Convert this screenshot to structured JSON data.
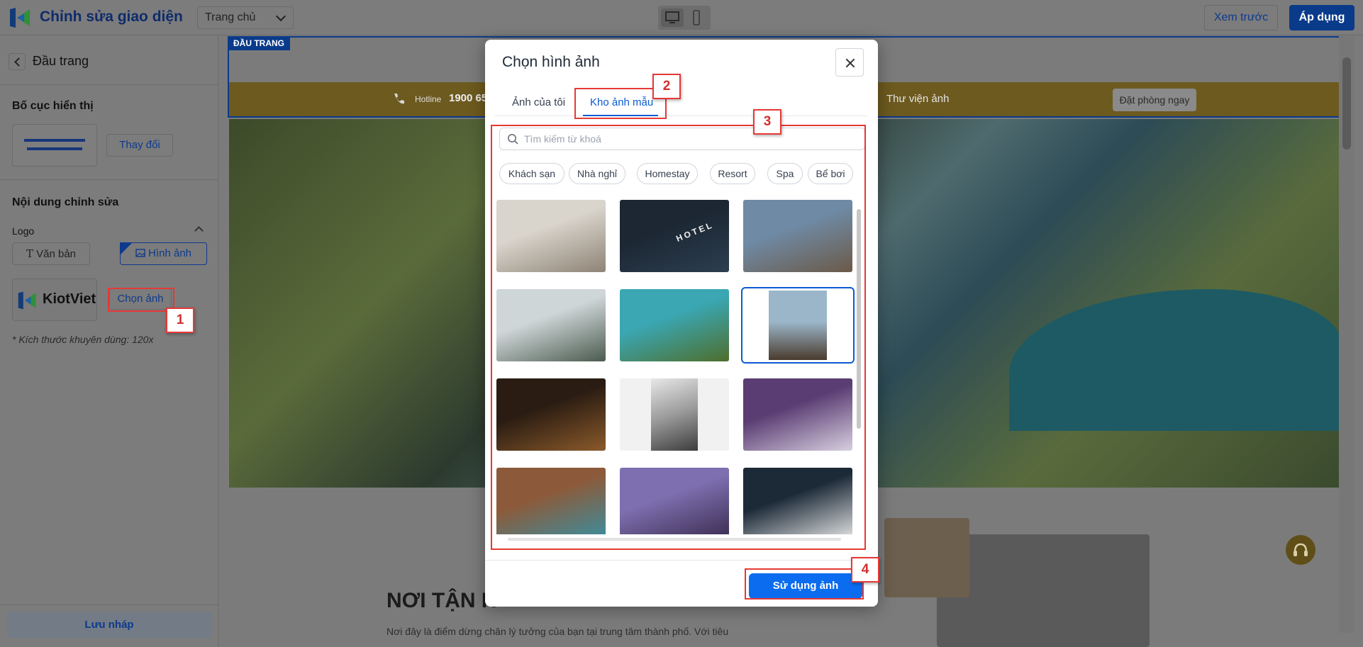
{
  "app": {
    "title": "Chỉnh sửa giao diện",
    "page_select": "Trang chủ",
    "preview_label": "Xem trước",
    "apply_label": "Áp dụng"
  },
  "left_panel": {
    "back_label": "Đầu trang",
    "layout_section": "Bố cục hiển thị",
    "change_label": "Thay đổi",
    "content_section": "Nội dung chỉnh sửa",
    "logo_label": "Logo",
    "option_text": "Văn bản",
    "option_image": "Hình ảnh",
    "logo_brand": "KiotViet",
    "choose_image": "Chọn ảnh",
    "size_hint": "* Kích thước khuyên dùng: 120x",
    "save_draft": "Lưu nháp"
  },
  "canvas": {
    "header_tag": "ĐẦU TRANG",
    "hotline_label": "Hotline",
    "hotline_number": "1900 652",
    "gallery_link": "Thư viện ảnh",
    "book_button": "Đặt phòng ngay",
    "section_heading": "NƠI TẬN H",
    "section_text": "Nơi đây là điểm dừng chân lý tưởng của bạn tại trung tâm thành phố. Với tiêu"
  },
  "modal": {
    "title": "Chọn hình ảnh",
    "tabs": [
      "Ảnh của tôi",
      "Kho ảnh mẫu"
    ],
    "active_tab": "Kho ảnh mẫu",
    "search_placeholder": "Tìm kiếm từ khoá",
    "chips": [
      "Khách sạn",
      "Nhà nghỉ",
      "Homestay",
      "Resort",
      "Spa",
      "Bể bơi"
    ],
    "images": [
      {
        "name": "pillows-bed",
        "colors": [
          "#d9d4cc",
          "#8e8476"
        ],
        "selected": false
      },
      {
        "name": "hotel-sign",
        "colors": [
          "#1c2733",
          "#2c3e50"
        ],
        "selected": false,
        "text": "HOTEL"
      },
      {
        "name": "mountain-resort",
        "colors": [
          "#6f8aa5",
          "#6b5a48"
        ],
        "selected": false
      },
      {
        "name": "hotel-courtyard",
        "colors": [
          "#cfd6d8",
          "#4b5b4f"
        ],
        "selected": false
      },
      {
        "name": "tropical-pool",
        "colors": [
          "#3aa7b3",
          "#4e6e2c"
        ],
        "selected": false
      },
      {
        "name": "palm-pool",
        "colors": [
          "#9bb6c9",
          "#4a3b2e"
        ],
        "selected": true
      },
      {
        "name": "hotel-corridor",
        "colors": [
          "#2a1c12",
          "#8b5a2b"
        ],
        "selected": false
      },
      {
        "name": "staircase",
        "colors": [
          "#e8e8e8",
          "#3d3d3d"
        ],
        "selected": false
      },
      {
        "name": "purple-bedroom",
        "colors": [
          "#5a3d73",
          "#d8cfe0"
        ],
        "selected": false
      },
      {
        "name": "indoor-pool",
        "colors": [
          "#8c5a3a",
          "#3a8fa0"
        ],
        "selected": false
      },
      {
        "name": "sunset-palms",
        "colors": [
          "#7e6fb0",
          "#3a2c4e"
        ],
        "selected": false
      },
      {
        "name": "dark-bedroom",
        "colors": [
          "#1c2a38",
          "#e6e6e6"
        ],
        "selected": false
      }
    ],
    "use_button": "Sử dụng ảnh"
  },
  "callouts": [
    "1",
    "2",
    "3",
    "4"
  ],
  "colors": {
    "primary": "#0b6cf0",
    "brand_dark": "#0a3a8a",
    "callout": "#e53935",
    "gold": "#6d5a1f"
  }
}
